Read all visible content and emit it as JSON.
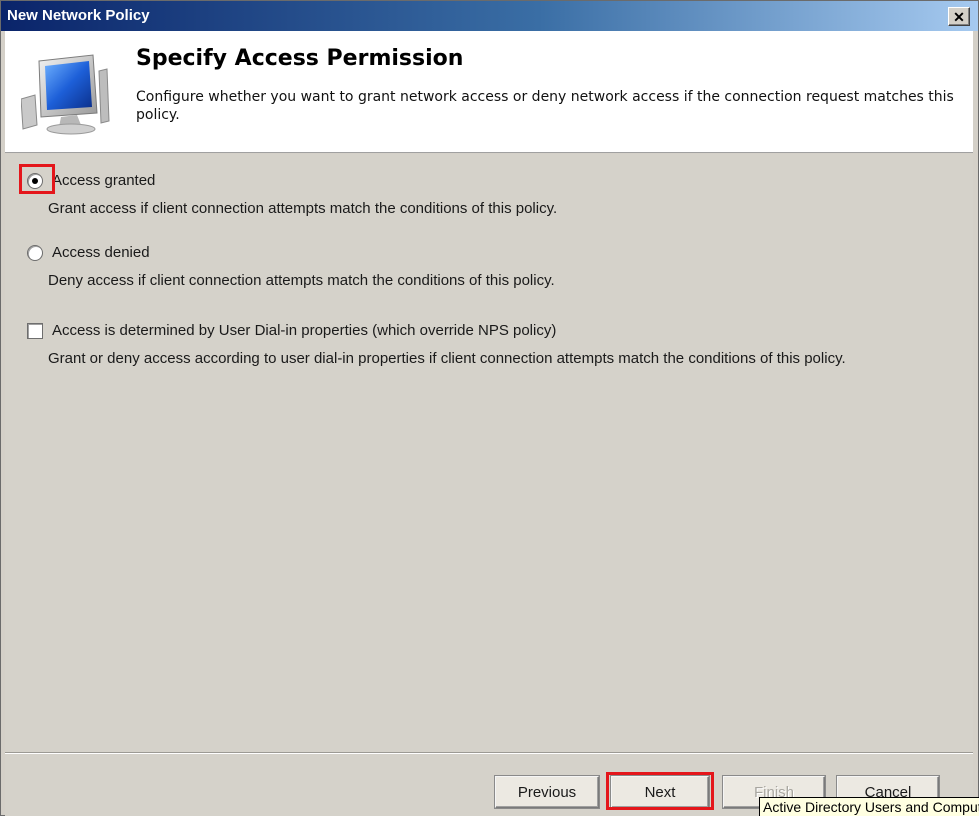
{
  "window": {
    "title": "New Network Policy",
    "close_glyph": "✕"
  },
  "header": {
    "icon": "network-monitor-icon",
    "title": "Specify Access Permission",
    "description": "Configure whether you want to grant network access or deny network access if the connection request matches this policy."
  },
  "options": {
    "granted": {
      "label": "Access granted",
      "description": "Grant access if client connection attempts match the conditions of this policy.",
      "selected": true
    },
    "denied": {
      "label": "Access denied",
      "description": "Deny access if client connection attempts match the conditions of this policy.",
      "selected": false
    },
    "dialin": {
      "label": "Access is determined by User Dial-in properties (which override NPS policy)",
      "description": "Grant or deny access according to user dial-in properties if client connection attempts match the conditions of this policy.",
      "checked": false
    }
  },
  "buttons": {
    "previous": "Previous",
    "next": "Next",
    "finish": "Finish",
    "cancel": "Cancel"
  },
  "tooltip": "Active Directory Users and Computers",
  "colors": {
    "highlight": "#e4161b",
    "titlebar": "#0a246a"
  }
}
